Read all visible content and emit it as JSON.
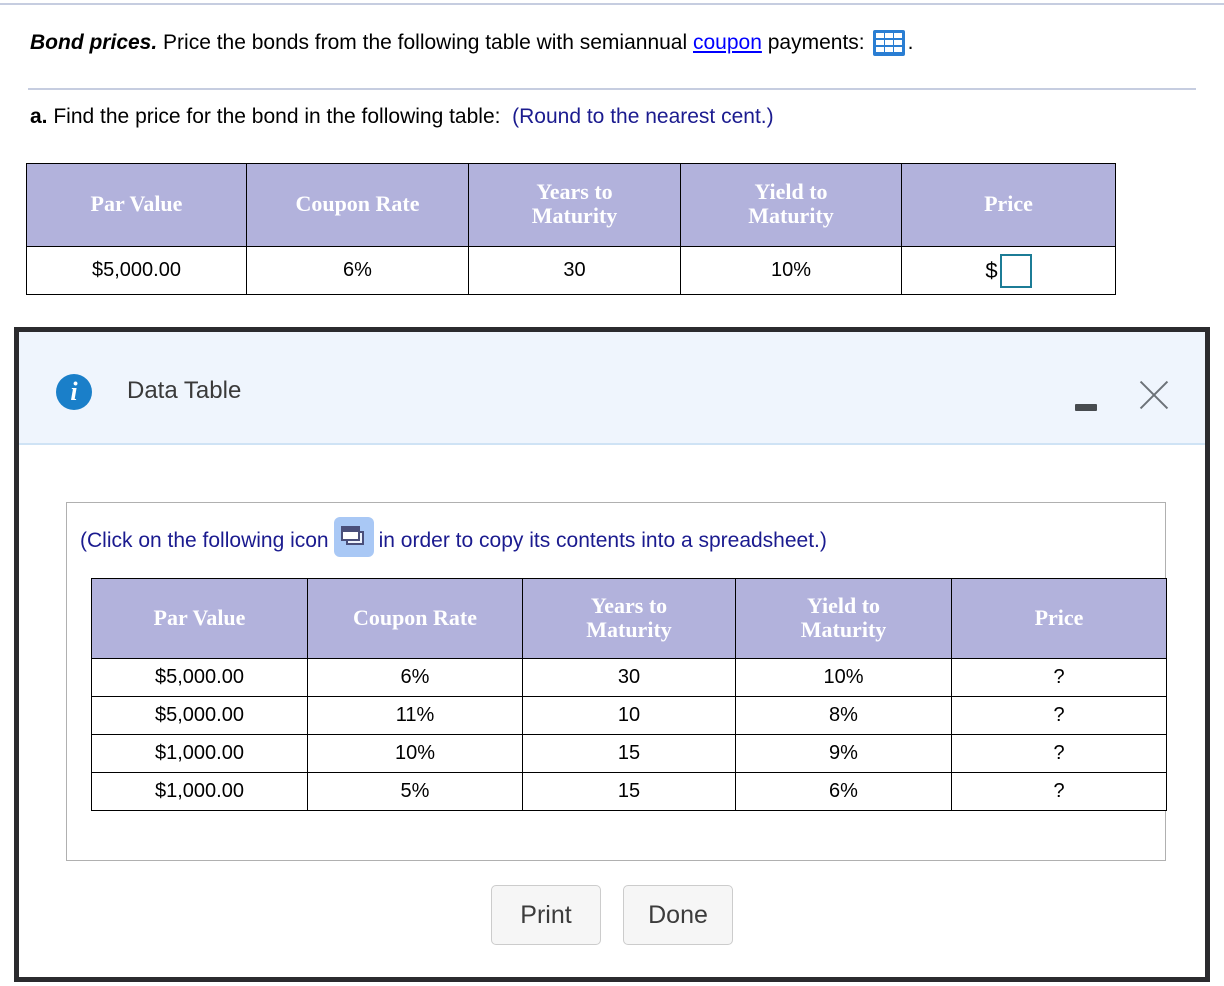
{
  "problem": {
    "lead": "Bond prices.",
    "statement_before_link": " Price the bonds from the following table with semiannual ",
    "link_text": "coupon",
    "statement_after_link": " payments:",
    "grid_icon_name": "table-grid-icon",
    "trailing_period": "."
  },
  "part_a": {
    "tag": "a.",
    "text": " Find the price for the bond in the following table:",
    "note": "(Round to the nearest cent.)"
  },
  "question_table": {
    "columns": [
      "Par Value",
      "Coupon Rate",
      "Years to Maturity",
      "Yield to Maturity",
      "Price"
    ],
    "columns_multiline": [
      [
        "Par Value"
      ],
      [
        "Coupon Rate"
      ],
      [
        "Years to",
        "Maturity"
      ],
      [
        "Yield to",
        "Maturity"
      ],
      [
        "Price"
      ]
    ],
    "row": {
      "par_value": "$5,000.00",
      "coupon_rate": "6%",
      "years_to_maturity": "30",
      "yield_to_maturity": "10%",
      "price_prefix": "$",
      "price_value": ""
    }
  },
  "dialog": {
    "title": "Data Table",
    "info_icon": "info-icon",
    "minimize_label": "minimize",
    "close_label": "close",
    "instruction_before_icon": "(Click on the following icon",
    "instruction_after_icon": "in order to copy its contents into a spreadsheet.)",
    "copy_icon_name": "copy-to-spreadsheet-icon",
    "buttons": {
      "print": "Print",
      "done": "Done"
    },
    "data_table": {
      "columns_multiline": [
        [
          "Par Value"
        ],
        [
          "Coupon Rate"
        ],
        [
          "Years to",
          "Maturity"
        ],
        [
          "Yield to",
          "Maturity"
        ],
        [
          "Price"
        ]
      ],
      "rows": [
        {
          "par_value": "$5,000.00",
          "coupon_rate": "6%",
          "years_to_maturity": "30",
          "yield_to_maturity": "10%",
          "price": "?"
        },
        {
          "par_value": "$5,000.00",
          "coupon_rate": "11%",
          "years_to_maturity": "10",
          "yield_to_maturity": "8%",
          "price": "?"
        },
        {
          "par_value": "$1,000.00",
          "coupon_rate": "10%",
          "years_to_maturity": "15",
          "yield_to_maturity": "9%",
          "price": "?"
        },
        {
          "par_value": "$1,000.00",
          "coupon_rate": "5%",
          "years_to_maturity": "15",
          "yield_to_maturity": "6%",
          "price": "?"
        }
      ]
    }
  },
  "colors": {
    "table_header_bg": "#b2b2dc",
    "link_blue": "#0000ff",
    "note_navy": "#1b1b8f",
    "dialog_header_bg": "#eff5fd",
    "dialog_border": "#2b2b2e",
    "answer_box_border": "#1c7c96",
    "info_icon_blue": "#1a7fc9"
  }
}
